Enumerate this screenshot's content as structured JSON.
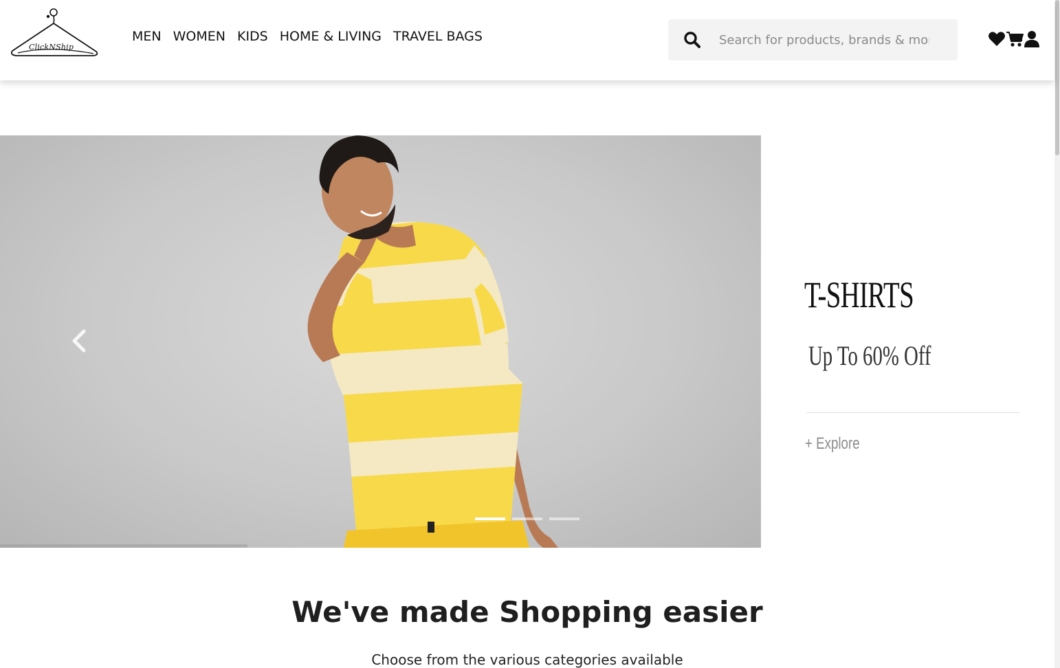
{
  "brand": {
    "logo_text": "ClickNShip"
  },
  "nav": {
    "items": [
      {
        "label": "MEN"
      },
      {
        "label": "WOMEN"
      },
      {
        "label": "KIDS"
      },
      {
        "label": "HOME & LIVING"
      },
      {
        "label": "TRAVEL BAGS"
      }
    ]
  },
  "search": {
    "placeholder": "Search for products, brands & more",
    "value": ""
  },
  "header_icons": [
    "heart-icon",
    "cart-icon",
    "user-icon"
  ],
  "carousel": {
    "slides_count": 3,
    "active_index": 0,
    "prev_icon": "chevron-left-icon"
  },
  "promo": {
    "title": "T-SHIRTS",
    "subtitle": "Up To 60% Off",
    "cta": "+ Explore"
  },
  "section": {
    "title": "We've made Shopping easier",
    "subtitle": "Choose from the various categories available"
  },
  "colors": {
    "header_bg": "#ffffff",
    "search_bg": "#f3f3f3",
    "text_dark": "#111111",
    "shirt_yellow": "#f7d94a",
    "shirt_cream": "#f5e9c4",
    "hero_bg": "#cfcfcf"
  }
}
